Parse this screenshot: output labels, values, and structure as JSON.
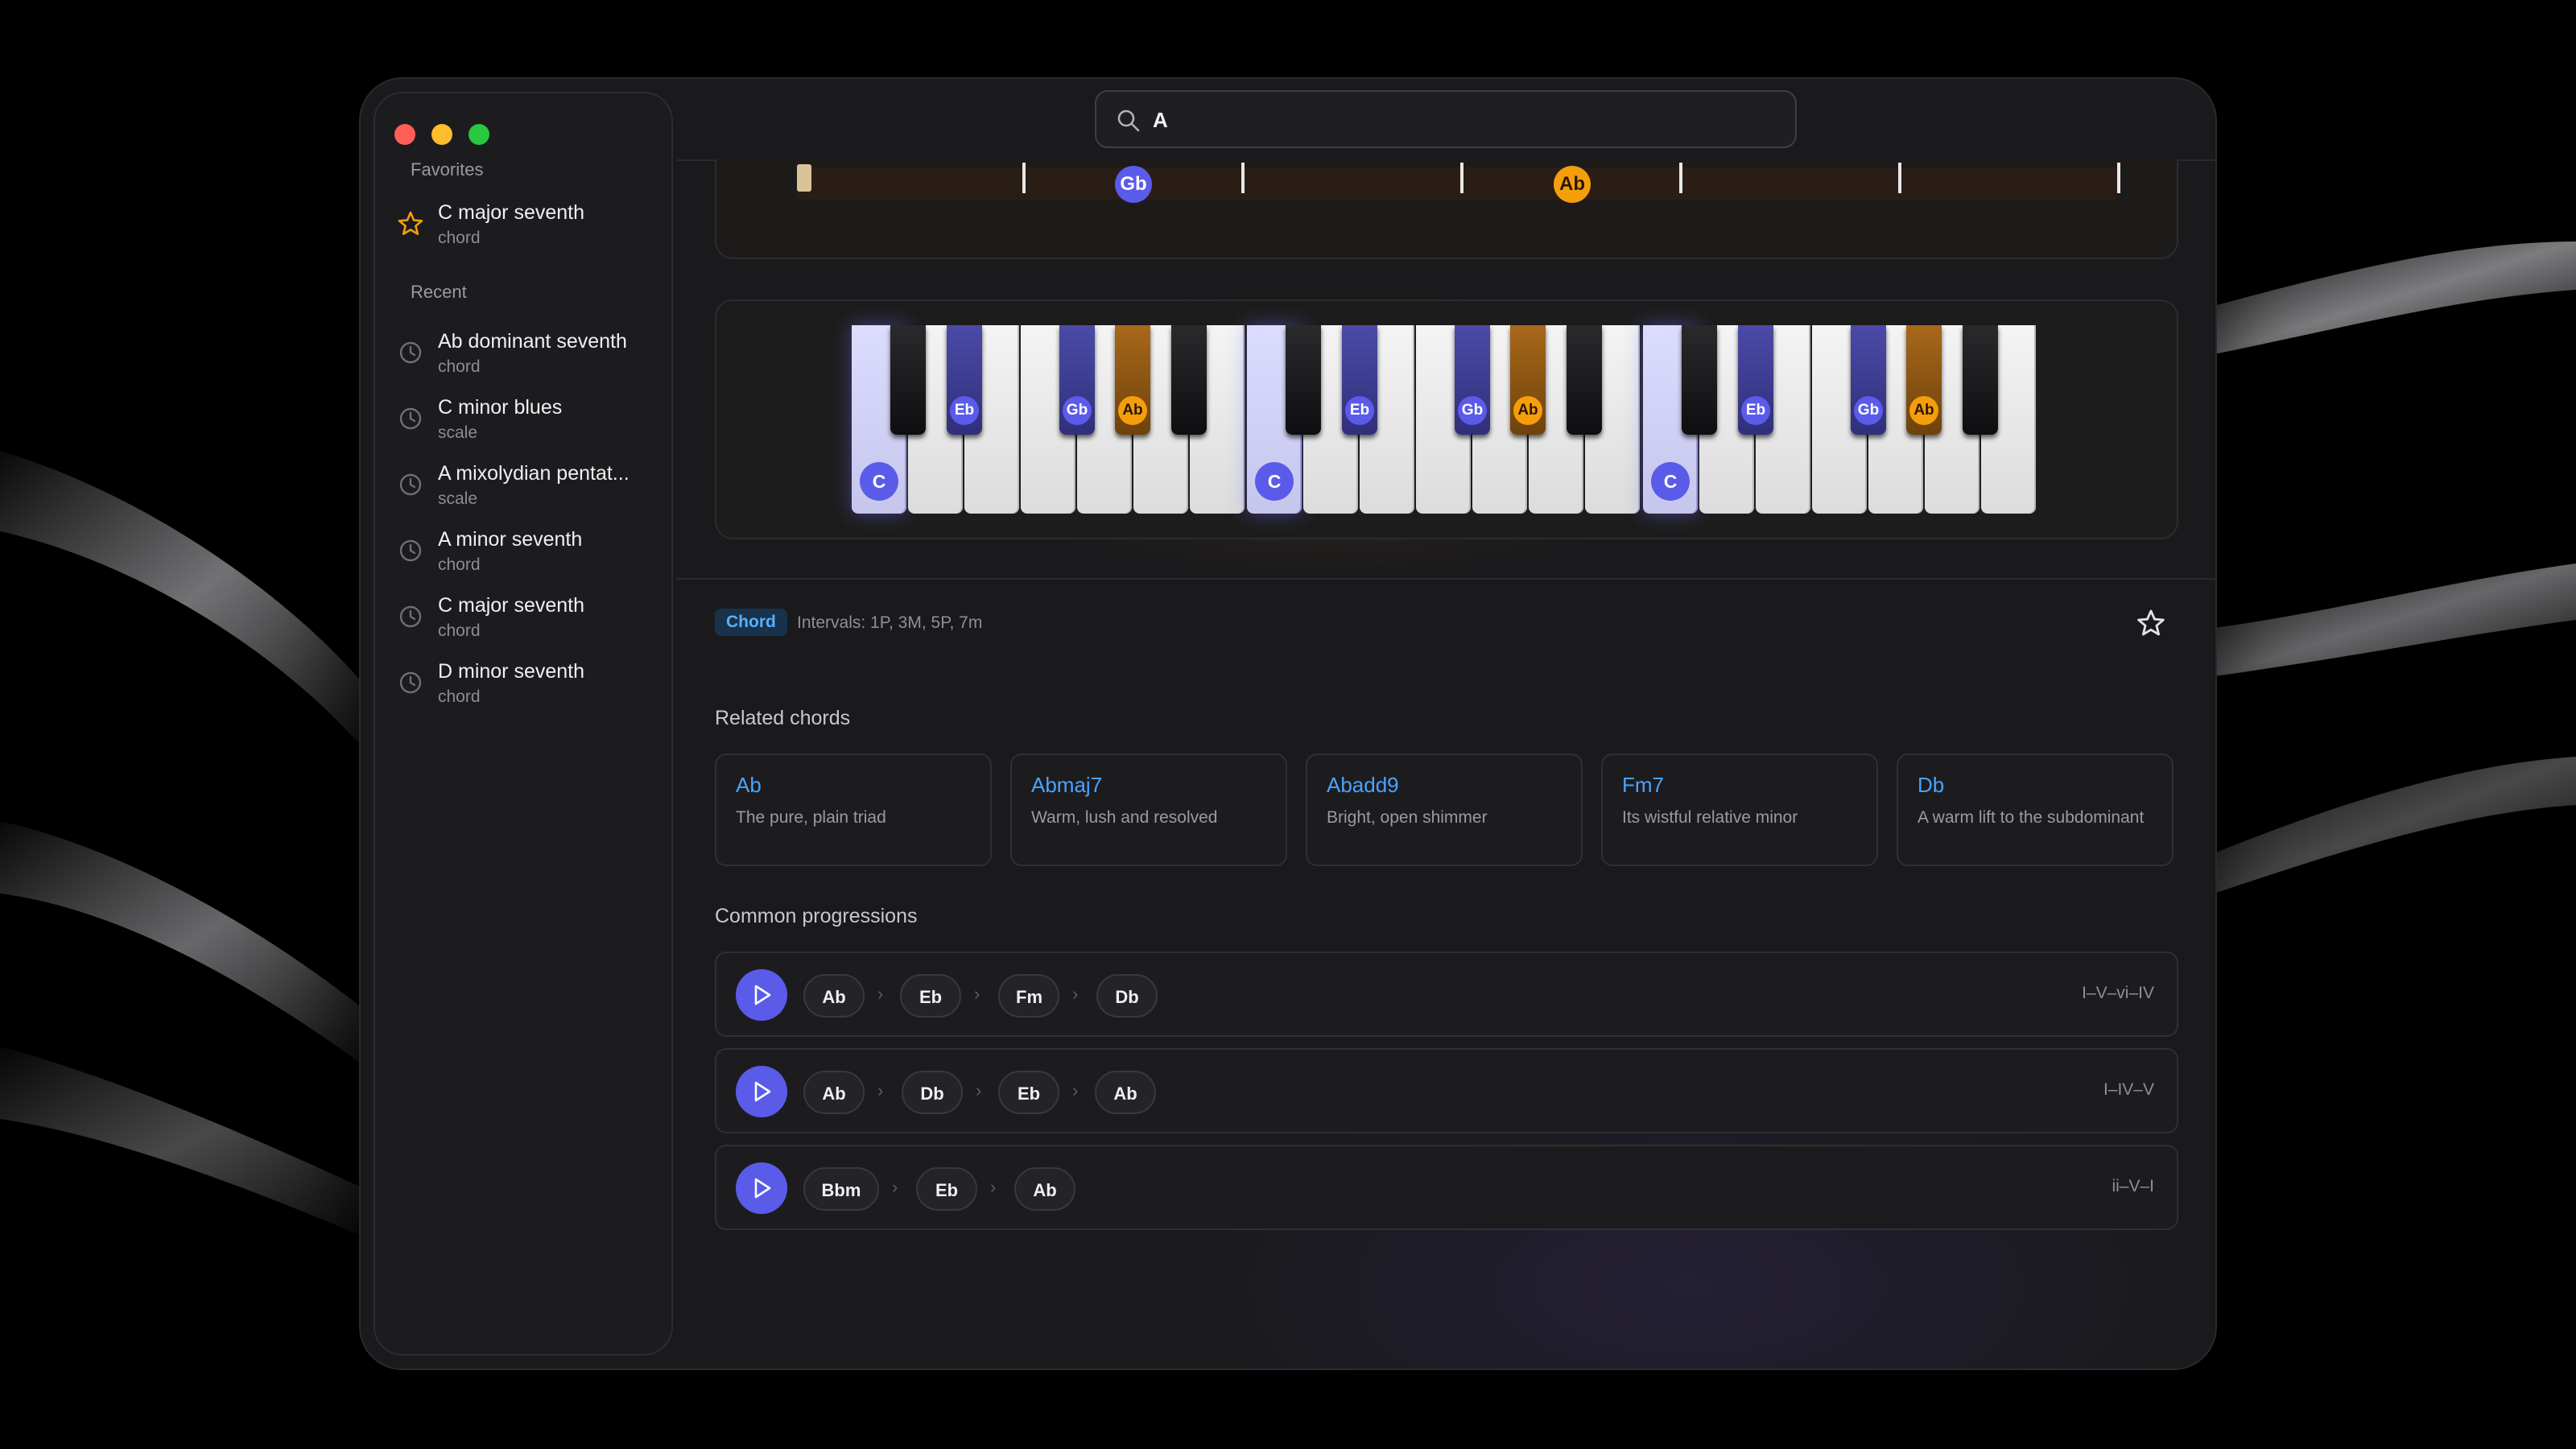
{
  "search": {
    "value": "A"
  },
  "sidebar": {
    "favorites_heading": "Favorites",
    "favorites": [
      {
        "title": "C major seventh",
        "type": "chord",
        "icon": "star-icon"
      }
    ],
    "recent_heading": "Recent",
    "recent": [
      {
        "title": "Ab dominant seventh",
        "type": "chord",
        "icon": "clock-icon"
      },
      {
        "title": "C minor blues",
        "type": "scale",
        "icon": "clock-icon"
      },
      {
        "title": "A mixolydian pentat...",
        "type": "scale",
        "icon": "clock-icon"
      },
      {
        "title": "A minor seventh",
        "type": "chord",
        "icon": "clock-icon"
      },
      {
        "title": "C major seventh",
        "type": "chord",
        "icon": "clock-icon"
      },
      {
        "title": "D minor seventh",
        "type": "chord",
        "icon": "clock-icon"
      }
    ]
  },
  "fretboard": {
    "markers": [
      {
        "label": "Gb",
        "color": "#5b5bea"
      },
      {
        "label": "Ab",
        "color": "#f59e0b"
      }
    ]
  },
  "keyboard": {
    "white_labels": [
      "C",
      "C",
      "C"
    ],
    "black_labels": [
      "Eb",
      "Gb",
      "Ab",
      "Eb",
      "Gb",
      "Ab",
      "Eb",
      "Gb",
      "Ab"
    ]
  },
  "info": {
    "badge": "Chord",
    "intervals": "Intervals: 1P, 3M, 5P, 7m"
  },
  "related": {
    "heading": "Related chords",
    "cards": [
      {
        "name": "Ab",
        "desc": "The pure, plain triad"
      },
      {
        "name": "Abmaj7",
        "desc": "Warm, lush and resolved"
      },
      {
        "name": "Abadd9",
        "desc": "Bright, open shimmer"
      },
      {
        "name": "Fm7",
        "desc": "Its wistful relative minor"
      },
      {
        "name": "Db",
        "desc": "A warm lift to the subdominant"
      }
    ]
  },
  "progressions": {
    "heading": "Common progressions",
    "items": [
      {
        "chords": [
          "Ab",
          "Eb",
          "Fm",
          "Db"
        ],
        "roman": "I–V–vi–IV"
      },
      {
        "chords": [
          "Ab",
          "Db",
          "Eb",
          "Ab"
        ],
        "roman": "I–IV–V"
      },
      {
        "chords": [
          "Bbm",
          "Eb",
          "Ab"
        ],
        "roman": "ii–V–I"
      }
    ]
  },
  "colors": {
    "accent_blue": "#5b5bea",
    "accent_orange": "#f59e0b",
    "link_blue": "#4aa3ff"
  }
}
